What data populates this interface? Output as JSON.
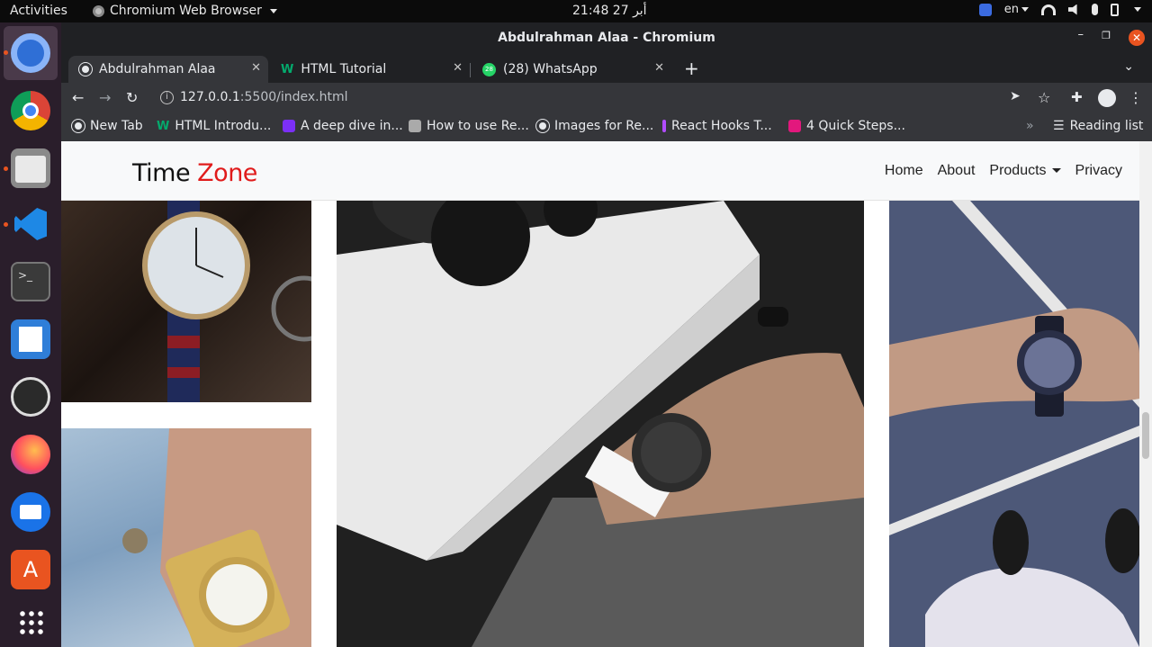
{
  "system": {
    "activities": "Activities",
    "app_menu": "Chromium Web Browser",
    "clock": "21:48  27 أبر",
    "language": "en"
  },
  "window": {
    "title": "Abdulrahman Alaa - Chromium"
  },
  "tabs": [
    {
      "label": "Abdulrahman Alaa"
    },
    {
      "label": "HTML Tutorial"
    },
    {
      "label": "(28) WhatsApp",
      "badge": "28"
    }
  ],
  "address": {
    "host": "127.0.0.1",
    "rest": ":5500/index.html"
  },
  "bookmarks": [
    {
      "label": "New Tab"
    },
    {
      "label": "HTML Introdu..."
    },
    {
      "label": "A deep dive in..."
    },
    {
      "label": "How to use Re..."
    },
    {
      "label": "Images for Re..."
    },
    {
      "label": "React Hooks T..."
    },
    {
      "label": "4 Quick Steps..."
    }
  ],
  "reading_list": "Reading list",
  "site": {
    "brand_time": "Time",
    "brand_zone": "Zone",
    "nav": {
      "home": "Home",
      "about": "About",
      "products": "Products",
      "privacy": "Privacy"
    },
    "brand_color": "#e01b1b"
  }
}
